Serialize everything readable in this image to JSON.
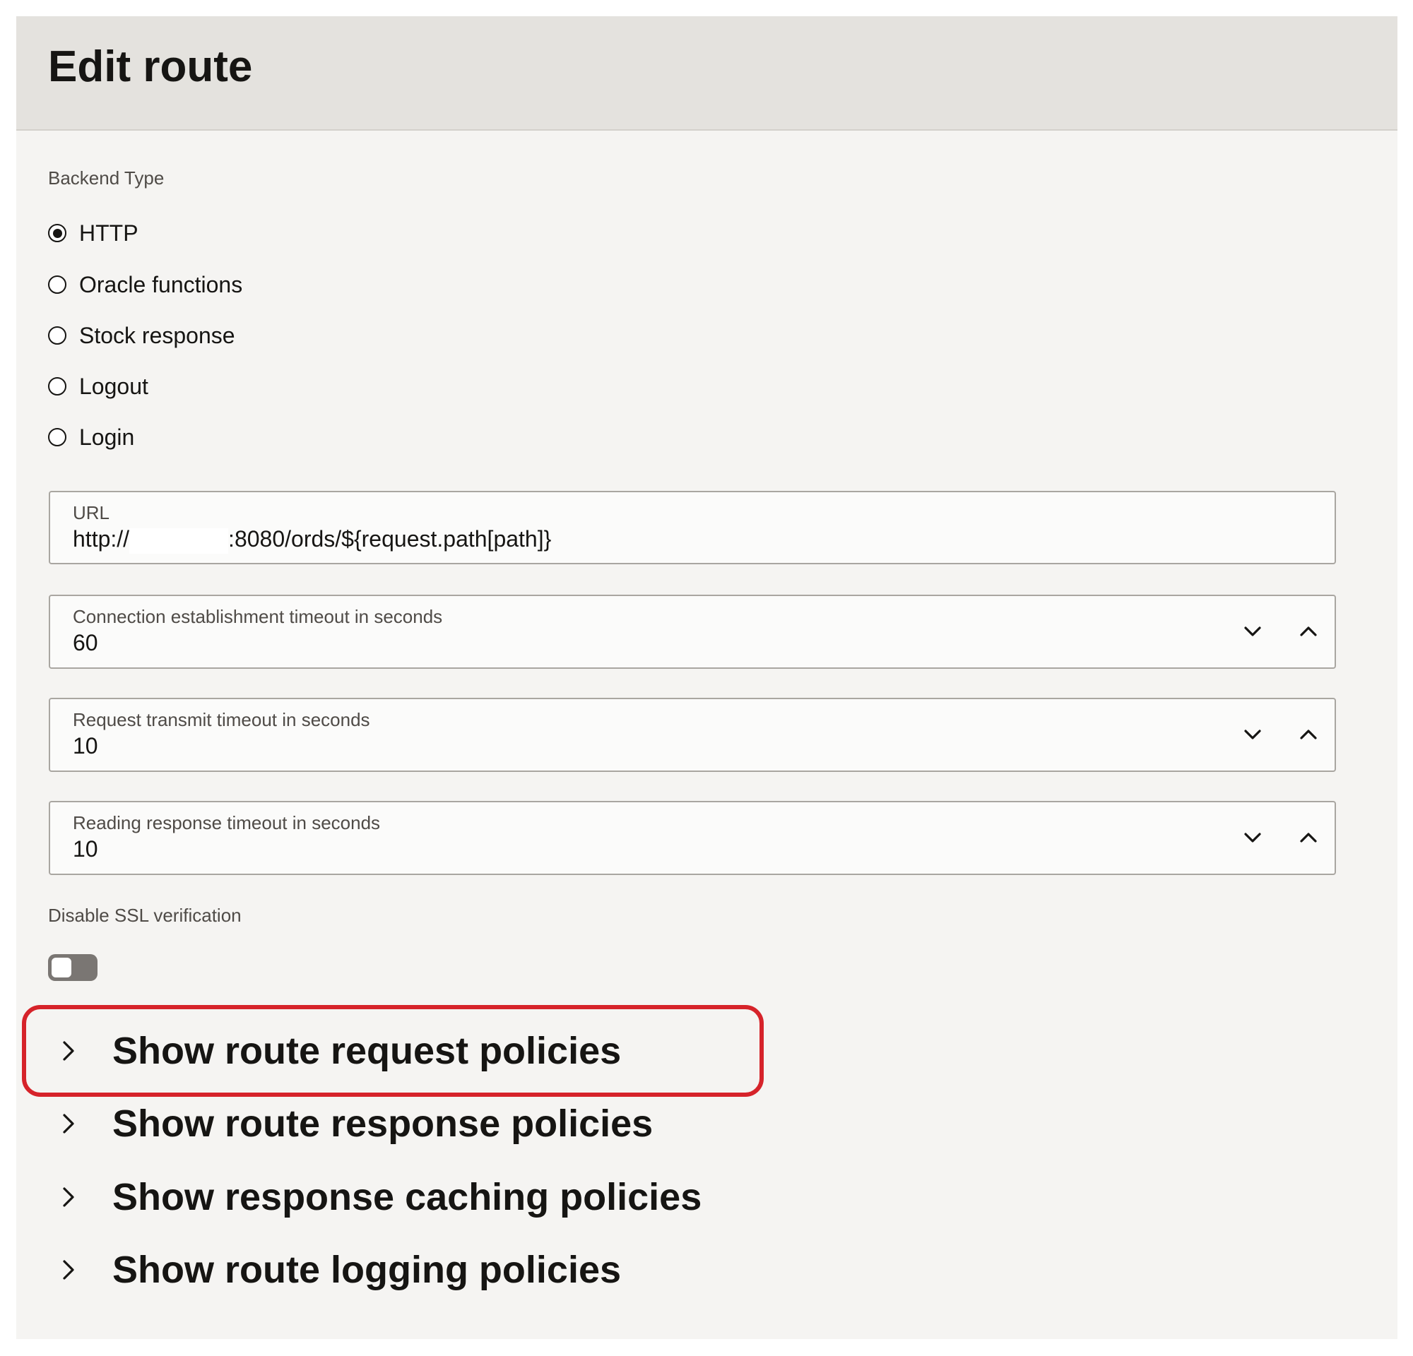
{
  "header": {
    "title": "Edit route"
  },
  "backend_type": {
    "label": "Backend Type",
    "options": [
      {
        "label": "HTTP",
        "checked": true
      },
      {
        "label": "Oracle functions",
        "checked": false
      },
      {
        "label": "Stock response",
        "checked": false
      },
      {
        "label": "Logout",
        "checked": false
      },
      {
        "label": "Login",
        "checked": false
      }
    ]
  },
  "url_field": {
    "label": "URL",
    "value_prefix": "http://",
    "value_suffix": ":8080/ords/${request.path[path]}"
  },
  "timeouts": {
    "connection": {
      "label": "Connection establishment timeout in seconds",
      "value": "60"
    },
    "request_transmit": {
      "label": "Request transmit timeout in seconds",
      "value": "10"
    },
    "reading_response": {
      "label": "Reading response timeout in seconds",
      "value": "10"
    }
  },
  "ssl": {
    "label": "Disable SSL verification",
    "enabled": false
  },
  "policies": {
    "request": "Show route request policies",
    "response": "Show route response policies",
    "caching": "Show response caching policies",
    "logging": "Show route logging policies"
  },
  "colors": {
    "highlight": "#d6232a",
    "header_bg": "#e4e2de",
    "page_bg": "#f5f4f2"
  }
}
